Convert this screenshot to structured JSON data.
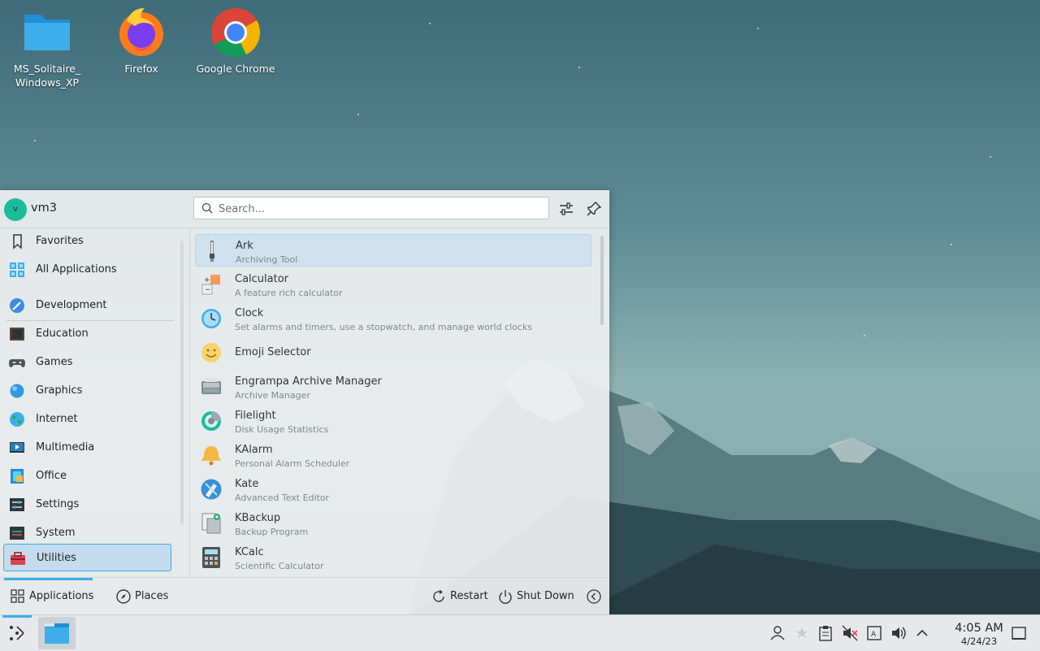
{
  "desktop": {
    "icons": [
      {
        "label_line1": "MS_Solitaire_",
        "label_line2": "Windows_XP",
        "icon": "folder-icon"
      },
      {
        "label_line1": "Firefox",
        "icon": "firefox-icon"
      },
      {
        "label_line1": "Google Chrome",
        "icon": "chrome-icon"
      }
    ]
  },
  "launcher": {
    "user": {
      "initial": "v",
      "name": "vm3"
    },
    "search": {
      "placeholder": "Search...",
      "value": ""
    },
    "header_icons": [
      "configure-icon",
      "pin-icon"
    ],
    "categories": [
      {
        "label": "Favorites",
        "icon": "bookmark-icon"
      },
      {
        "label": "All Applications",
        "icon": "grid-icon"
      },
      {
        "label": "Development",
        "icon": "development-icon"
      },
      {
        "label": "Education",
        "icon": "education-icon"
      },
      {
        "label": "Games",
        "icon": "gamepad-icon"
      },
      {
        "label": "Graphics",
        "icon": "graphics-icon"
      },
      {
        "label": "Internet",
        "icon": "globe-icon"
      },
      {
        "label": "Multimedia",
        "icon": "multimedia-icon"
      },
      {
        "label": "Office",
        "icon": "office-icon"
      },
      {
        "label": "Settings",
        "icon": "settings-icon"
      },
      {
        "label": "System",
        "icon": "system-icon"
      },
      {
        "label": "Utilities",
        "icon": "toolbox-icon",
        "selected": true
      }
    ],
    "apps": [
      {
        "name": "Ark",
        "desc": "Archiving Tool",
        "icon": "zip-icon"
      },
      {
        "name": "Calculator",
        "desc": "A feature rich calculator",
        "icon": "calculator-icon"
      },
      {
        "name": "Clock",
        "desc": "Set alarms and timers, use a stopwatch, and manage world clocks",
        "icon": "clock-icon"
      },
      {
        "name": "Emoji Selector",
        "desc": "",
        "icon": "emoji-icon"
      },
      {
        "name": "Engrampa Archive Manager",
        "desc": "Archive Manager",
        "icon": "archive-icon"
      },
      {
        "name": "Filelight",
        "desc": "Disk Usage Statistics",
        "icon": "filelight-icon"
      },
      {
        "name": "KAlarm",
        "desc": "Personal Alarm Scheduler",
        "icon": "bell-icon"
      },
      {
        "name": "Kate",
        "desc": "Advanced Text Editor",
        "icon": "kate-icon"
      },
      {
        "name": "KBackup",
        "desc": "Backup Program",
        "icon": "backup-icon"
      },
      {
        "name": "KCalc",
        "desc": "Scientific Calculator",
        "icon": "kcalc-icon"
      }
    ],
    "footer": {
      "applications": "Applications",
      "places": "Places",
      "restart": "Restart",
      "shutdown": "Shut Down"
    }
  },
  "taskbar": {
    "clock_time": "4:05 AM",
    "clock_date": "4/24/23",
    "tray_icons": [
      "user-icon",
      "network-icon",
      "clipboard-icon",
      "mute-icon",
      "keyboard-layout-icon",
      "volume-icon",
      "chevron-up-icon",
      "show-desktop-icon"
    ]
  },
  "colors": {
    "accent": "#3daee9",
    "selection": "#c5dcee",
    "panel": "#eff0f1"
  }
}
